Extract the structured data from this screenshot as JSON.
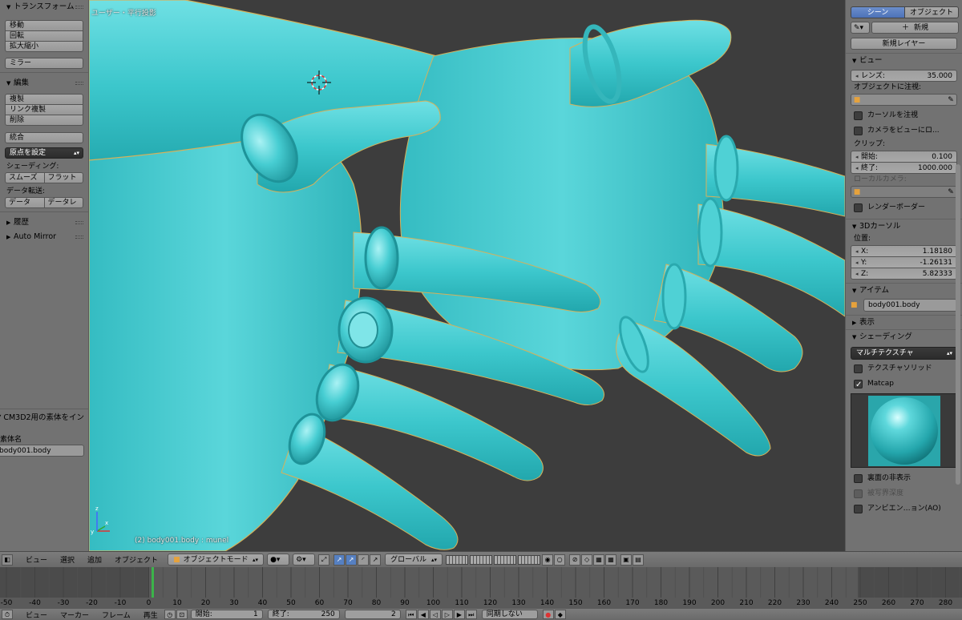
{
  "left_panel": {
    "transform": {
      "header": "トランスフォーム",
      "buttons": [
        "移動",
        "回転",
        "拡大縮小"
      ],
      "mirror": "ミラー"
    },
    "edit": {
      "header": "編集",
      "buttons": [
        "複製",
        "リンク複製",
        "削除"
      ],
      "join": "統合",
      "set_origin": "原点を設定",
      "shading_label": "シェーディング:",
      "smooth": "スムーズ",
      "flat": "フラット",
      "data_transfer_label": "データ転送:",
      "data": "データ",
      "data_layout": "データレ"
    },
    "history": "履歴",
    "auto_mirror": "Auto Mirror",
    "cm3d2": {
      "header": "CM3D2用の素体をイン",
      "label": "素体名",
      "value": "body001.body"
    }
  },
  "viewport": {
    "title": "ユーザー・平行投影",
    "status": "(2) body001.body : munel",
    "colors": {
      "skin": "#3cc7cc",
      "skin_light": "#8fe9ec",
      "skin_dark": "#1f9aa0",
      "background": "#3d3d3d"
    }
  },
  "right_panel": {
    "tabs": [
      "シーン",
      "オブジェクト"
    ],
    "new": "新規",
    "new_layer": "新規レイヤー",
    "view": {
      "header": "ビュー",
      "lens_label": "レンズ:",
      "lens_value": "35.000",
      "lock_object_label": "オブジェクトに注視:",
      "lock_cursor": "カーソルを注視",
      "lock_camera": "カメラをビューにロ...",
      "clip_label": "クリップ:",
      "clip_start_label": "開始:",
      "clip_start": "0.100",
      "clip_end_label": "終了:",
      "clip_end": "1000.000",
      "local_camera": "ローカルカメラ:",
      "render_border": "レンダーボーダー"
    },
    "cursor": {
      "header": "3Dカーソル",
      "location_label": "位置:",
      "x_label": "X:",
      "x": "1.18180",
      "y_label": "Y:",
      "y": "-1.26131",
      "z_label": "Z:",
      "z": "5.82333"
    },
    "item": {
      "header": "アイテム",
      "name": "body001.body"
    },
    "display": {
      "header": "表示"
    },
    "shading": {
      "header": "シェーディング",
      "mode": "マルチテクスチャ",
      "textured_solid": "テクスチャソリッド",
      "matcap": "Matcap",
      "backface_culling": "裏面の非表示",
      "depth_of_field": "被写界深度",
      "ambient_occlusion": "アンビエン…ョン(AO)"
    }
  },
  "view3d_header": {
    "menus": [
      "ビュー",
      "選択",
      "追加",
      "オブジェクト"
    ],
    "mode": "オブジェクトモード",
    "orientation": "グローバル"
  },
  "timeline": {
    "labels": [
      "-50",
      "-40",
      "-30",
      "-20",
      "-10",
      "0",
      "10",
      "20",
      "30",
      "40",
      "50",
      "60",
      "70",
      "80",
      "90",
      "100",
      "110",
      "120",
      "130",
      "140",
      "150",
      "160",
      "170",
      "180",
      "190",
      "200",
      "210",
      "220",
      "230",
      "240",
      "250",
      "260",
      "270",
      "280"
    ],
    "current_frame": 1,
    "menus": [
      "ビュー",
      "マーカー",
      "フレーム",
      "再生"
    ],
    "start_label": "開始:",
    "start": "1",
    "end_label": "終了:",
    "end": "250",
    "current": "2",
    "sync": "同期しない"
  }
}
